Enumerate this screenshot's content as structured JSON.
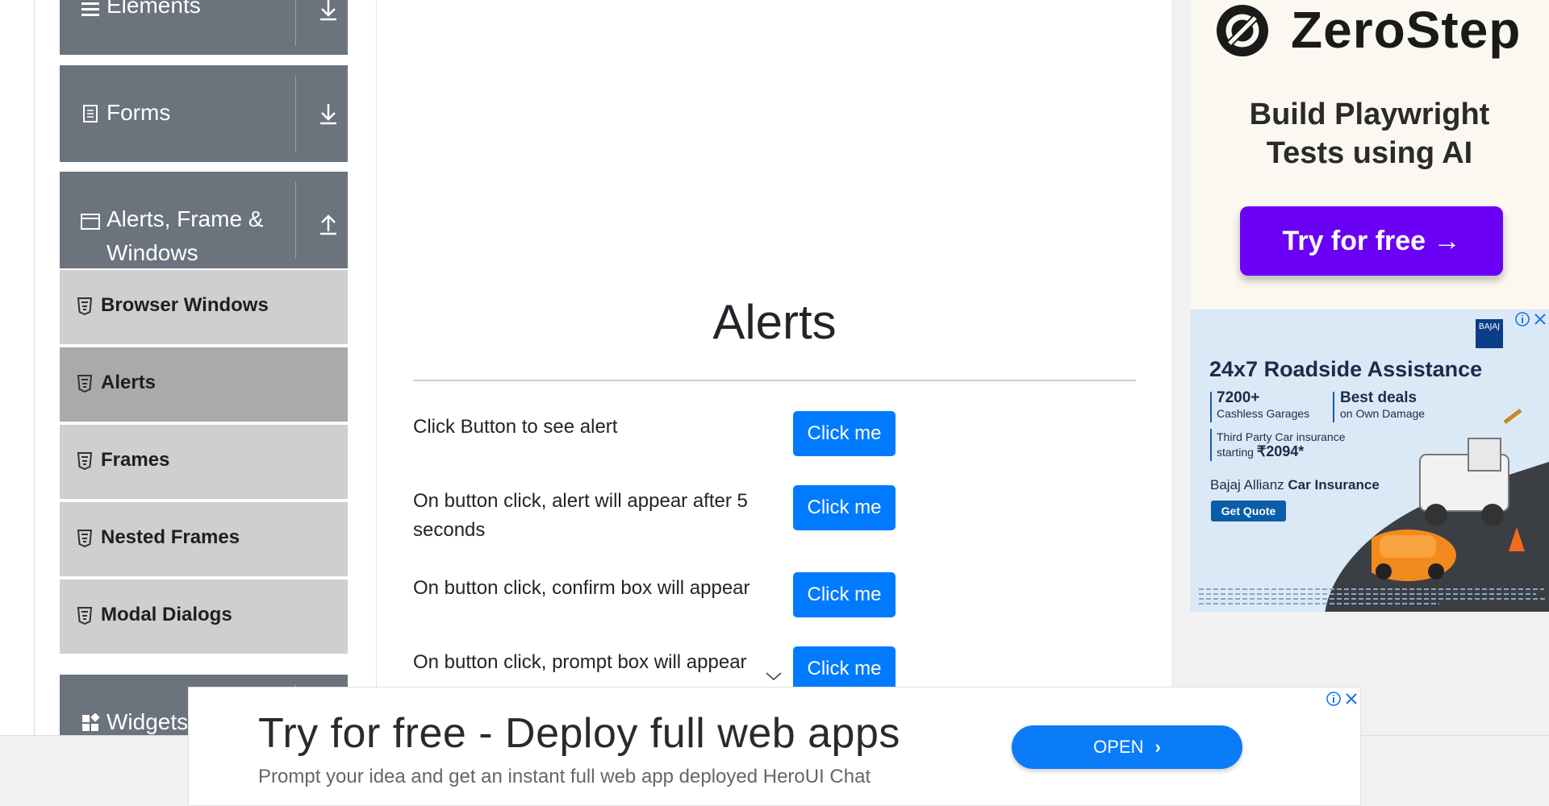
{
  "sidebar": {
    "groups": {
      "elements": {
        "label": "Elements"
      },
      "forms": {
        "label": "Forms"
      },
      "alerts_frame_windows": {
        "label": "Alerts, Frame & Windows",
        "line1": "Alerts, Frame &",
        "line2": "Windows"
      },
      "widgets": {
        "label": "Widgets"
      }
    },
    "items": [
      {
        "label": "Browser Windows"
      },
      {
        "label": "Alerts",
        "active": true
      },
      {
        "label": "Frames"
      },
      {
        "label": "Nested Frames"
      },
      {
        "label": "Modal Dialogs"
      }
    ],
    "colors": {
      "group_bg": "#6b737d",
      "item_bg": "#cfcfcf",
      "item_active_bg": "#aaaaaa"
    }
  },
  "main": {
    "title": "Alerts",
    "rows": [
      {
        "text": "Click Button to see alert",
        "button_label": "Click me"
      },
      {
        "text": "On button click, alert will appear after 5 seconds",
        "button_label": "Click me"
      },
      {
        "text": "On button click, confirm box will appear",
        "button_label": "Click me"
      },
      {
        "text": "On button click, prompt box will appear",
        "button_label": "Click me"
      }
    ],
    "colors": {
      "button_bg": "#007bff"
    }
  },
  "ads": {
    "zerostep": {
      "brand": "ZeroStep",
      "headline_line1": "Build Playwright",
      "headline_line2": "Tests using AI",
      "cta": "Try for free →",
      "cta_color": "#6a00f4"
    },
    "bajaj": {
      "title": "24x7 Roadside Assistance",
      "stat1_big": "7200+",
      "stat1_small": "Cashless Garages",
      "stat2_big": "Best deals",
      "stat2_small": "on Own Damage",
      "stat3_small": "Third Party Car insurance",
      "stat3_prefix": "starting",
      "stat3_big": "₹2094*",
      "brand_prefix": "Bajaj Allianz",
      "brand_bold": "Car Insurance",
      "cta": "Get Quote",
      "logo_text": "BAJAJ"
    },
    "bottom": {
      "headline": "Try for free - Deploy full web apps",
      "subtext": "Prompt your idea and get an instant full web app deployed HeroUI Chat",
      "cta": "OPEN",
      "cta_color": "#0a7cf7"
    }
  }
}
